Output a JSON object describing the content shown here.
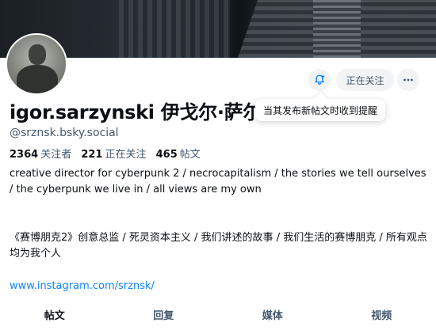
{
  "profile": {
    "display_name": "igor.sarzynski  伊戈尔·萨尔",
    "handle": "@srznsk.bsky.social",
    "followers_count": "2364",
    "followers_label": "关注者",
    "following_count": "221",
    "following_label": "正在关注",
    "posts_count": "465",
    "posts_label": "帖文",
    "bio_en": "creative director for cyberpunk 2 / necrocapitalism / the stories we tell ourselves / the cyberpunk we live in / all views are my own",
    "bio_cn": "《赛博朋克2》创意总监 / 死灵资本主义 / 我们讲述的故事 / 我们生活的赛博朋克 / 所有观点均为我个人",
    "link": "www.instagram.com/srznsk/"
  },
  "actions": {
    "follow_label": "正在关注",
    "notify_tooltip": "当其发布新帖文时收到提醒"
  },
  "tabs": [
    {
      "label": "帖文"
    },
    {
      "label": "回复"
    },
    {
      "label": "媒体"
    },
    {
      "label": "视频"
    }
  ],
  "colors": {
    "accent": "#1083fe",
    "muted": "#42576c",
    "text": "#0b0f14",
    "button_bg": "#f1f3f5"
  },
  "icons": {
    "notify": "bell-plus-icon",
    "more": "ellipsis-icon"
  }
}
